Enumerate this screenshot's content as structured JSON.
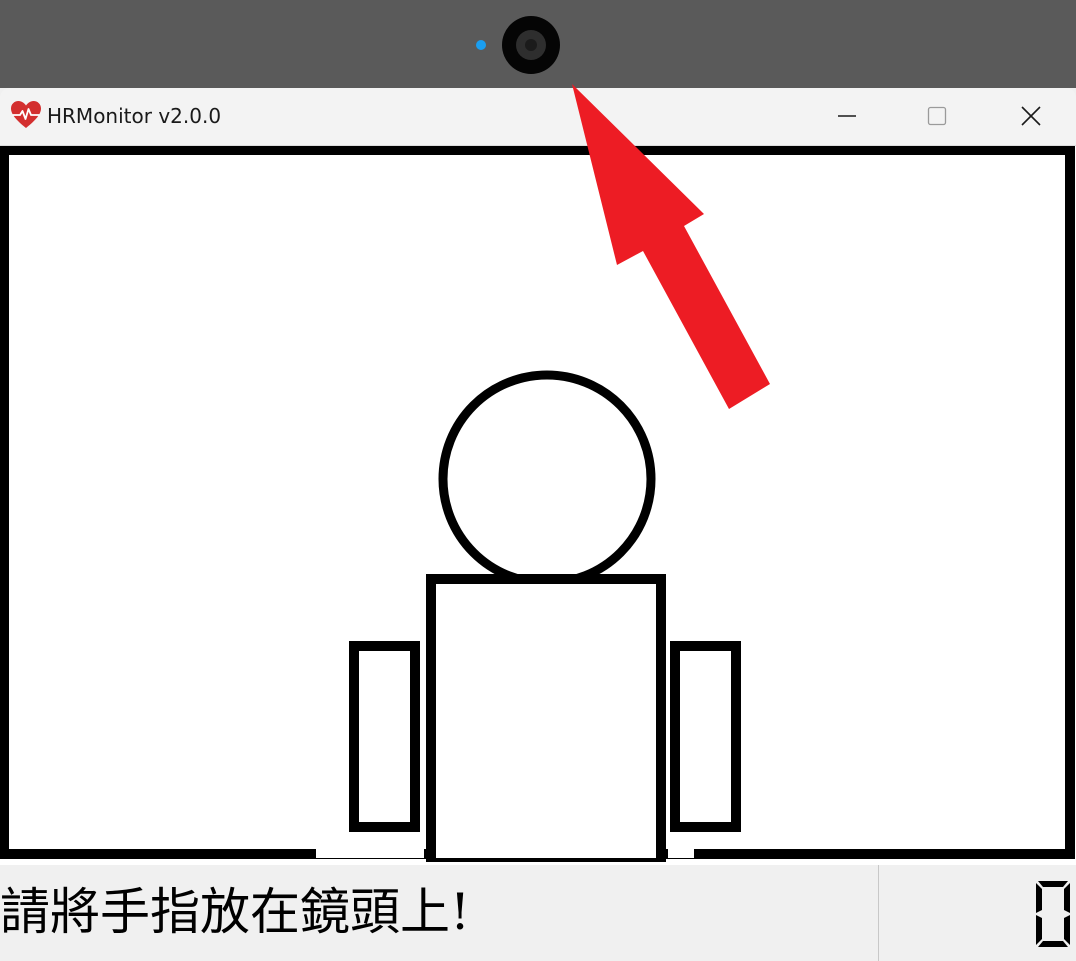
{
  "window": {
    "title": "HRMonitor v2.0.0",
    "icon": "heart-pulse-icon",
    "controls": [
      "minimize-icon",
      "maximize-icon",
      "close-icon"
    ]
  },
  "camera": {
    "led_color": "#1a9ef0"
  },
  "canvas": {
    "illustration": "person-outline",
    "arrow_color": "#ed1c24"
  },
  "status": {
    "message": "請將手指放在鏡頭上!",
    "bpm_value": "0"
  },
  "colors": {
    "accent": "#ed1c24",
    "heart": "#d32f2f",
    "titlebar": "#f3f3f3",
    "statusbar": "#f0f0f0"
  }
}
